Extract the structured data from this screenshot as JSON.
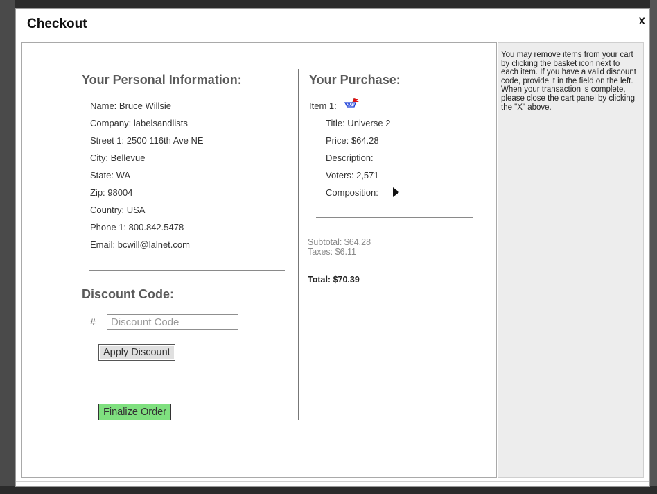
{
  "dialog": {
    "title": "Checkout",
    "close_label": "X"
  },
  "personal": {
    "heading": "Your Personal Information:",
    "name": "Name: Bruce Willsie",
    "company": "Company: labelsandlists",
    "street1": "Street 1: 2500 116th Ave NE",
    "city": "City: Bellevue",
    "state": "State: WA",
    "zip": "Zip: 98004",
    "country": "Country: USA",
    "phone1": "Phone 1: 800.842.5478",
    "email": "Email: bcwill@lalnet.com"
  },
  "discount": {
    "heading": "Discount Code:",
    "hash": "#",
    "placeholder": "Discount Code",
    "value": "",
    "apply_label": "Apply Discount"
  },
  "order": {
    "finalize_label": "Finalize Order"
  },
  "purchase": {
    "heading": "Your Purchase:",
    "item_label": "Item 1:",
    "item_icon": "basket-remove-icon",
    "title": "Title: Universe 2",
    "price": "Price: $64.28",
    "description": "Description:",
    "voters": "Voters: 2,571",
    "composition": "Composition:",
    "composition_icon": "play-triangle-icon"
  },
  "summary": {
    "subtotal": "Subtotal: $64.28",
    "taxes": "Taxes: $6.11",
    "total": "Total: $70.39"
  },
  "help": {
    "text": "You may remove items from your cart by clicking the basket icon next to each item. If you have a valid discount code, provide it in the field on the left. When your transaction is complete, please close the cart panel by clicking the \"X\" above."
  },
  "colors": {
    "finalize_bg": "#7fe07f",
    "heading_gray": "#5a5a5a",
    "help_bg": "#ededed"
  }
}
